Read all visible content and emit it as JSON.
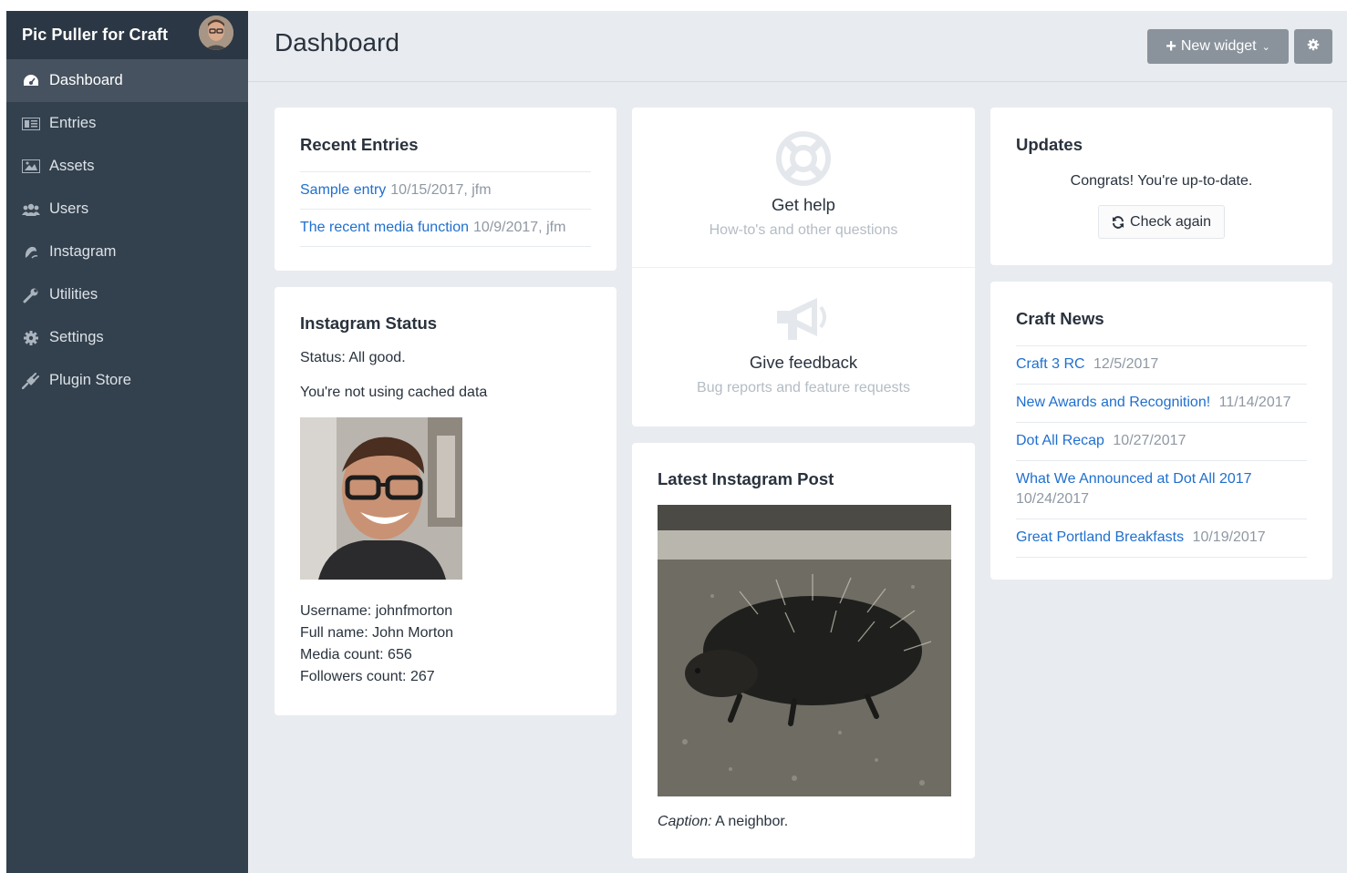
{
  "sidebar": {
    "site_name": "Pic Puller for Craft",
    "items": [
      {
        "label": "Dashboard",
        "icon": "dashboard-icon",
        "active": true
      },
      {
        "label": "Entries",
        "icon": "entries-icon"
      },
      {
        "label": "Assets",
        "icon": "assets-icon"
      },
      {
        "label": "Users",
        "icon": "users-icon"
      },
      {
        "label": "Instagram",
        "icon": "instagram-icon"
      },
      {
        "label": "Utilities",
        "icon": "wrench-icon"
      },
      {
        "label": "Settings",
        "icon": "gear-icon"
      },
      {
        "label": "Plugin Store",
        "icon": "plug-icon"
      }
    ]
  },
  "header": {
    "title": "Dashboard",
    "new_widget_label": "New widget"
  },
  "recent_entries": {
    "title": "Recent Entries",
    "entries": [
      {
        "title": "Sample entry",
        "meta": "10/15/2017, jfm"
      },
      {
        "title": "The recent media function",
        "meta": "10/9/2017, jfm"
      }
    ]
  },
  "instagram_status": {
    "title": "Instagram Status",
    "status": "Status: All good.",
    "cache": "You're not using cached data",
    "username": "Username: johnfmorton",
    "full_name": "Full name: John Morton",
    "media_count": "Media count: 656",
    "followers_count": "Followers count: 267"
  },
  "help": {
    "get_help_title": "Get help",
    "get_help_sub": "How-to's and other questions",
    "feedback_title": "Give feedback",
    "feedback_sub": "Bug reports and feature requests"
  },
  "latest_post": {
    "title": "Latest Instagram Post",
    "caption_label": "Caption:",
    "caption_text": "A neighbor."
  },
  "updates": {
    "title": "Updates",
    "message": "Congrats! You're up-to-date.",
    "check_label": "Check again"
  },
  "craft_news": {
    "title": "Craft News",
    "items": [
      {
        "title": "Craft 3 RC",
        "date": "12/5/2017"
      },
      {
        "title": "New Awards and Recognition!",
        "date": "11/14/2017"
      },
      {
        "title": "Dot All Recap",
        "date": "10/27/2017"
      },
      {
        "title": "What We Announced at Dot All 2017",
        "date": "10/24/2017"
      },
      {
        "title": "Great Portland Breakfasts",
        "date": "10/19/2017"
      }
    ]
  },
  "colors": {
    "sidebar_bg": "#33404d",
    "accent_link": "#1f6fcf",
    "main_bg": "#e8ebef"
  }
}
